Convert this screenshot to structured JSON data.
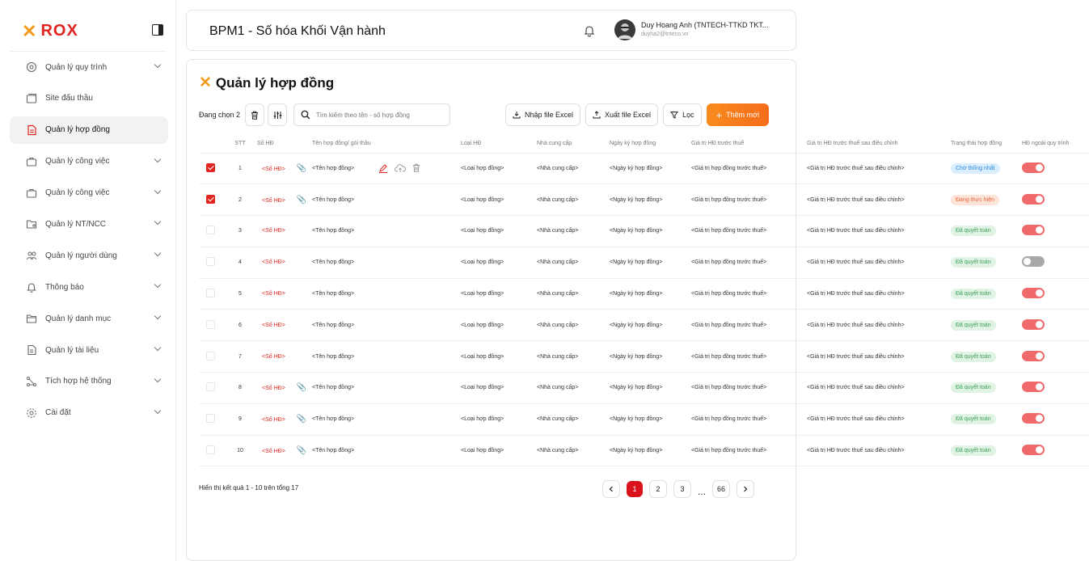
{
  "brand": {
    "name": "ROX"
  },
  "header": {
    "title": "BPM1 - Số hóa Khối Vận hành",
    "user_name": "Duy Hoang Anh (TNTECH-TTKD TKT...",
    "user_email": "duyha2@tnteco.vn"
  },
  "sidebar": {
    "items": [
      {
        "label": "Quản lý quy trình",
        "icon": "process-icon"
      },
      {
        "label": "Site đấu thầu",
        "icon": "window-icon"
      },
      {
        "label": "Quản lý hợp đồng",
        "icon": "document-icon"
      },
      {
        "label": "Quản lý công việc",
        "icon": "briefcase-icon"
      },
      {
        "label": "Quản lý công việc",
        "icon": "briefcase-icon"
      },
      {
        "label": "Quản lý NT/NCC",
        "icon": "folder-user-icon"
      },
      {
        "label": "Quản lý người dùng",
        "icon": "users-icon"
      },
      {
        "label": "Thông báo",
        "icon": "bell-icon"
      },
      {
        "label": "Quản lý danh mục",
        "icon": "folder-icon"
      },
      {
        "label": "Quản lý tài liệu",
        "icon": "file-icon"
      },
      {
        "label": "Tích hợp hệ thống",
        "icon": "integration-icon"
      },
      {
        "label": "Cài đặt",
        "icon": "gear-icon"
      }
    ],
    "active_index": 2
  },
  "page": {
    "title": "Quản lý hợp đồng",
    "selected_text": "Đang chọn 2",
    "search_placeholder": "Tìm kiếm theo tên - số hợp đồng",
    "import_label": "Nhập file Excel",
    "export_label": "Xuất file Excel",
    "filter_label": "Lọc",
    "add_label": "Thêm mới"
  },
  "table": {
    "columns": [
      "STT",
      "Số HĐ",
      "Tên hợp đồng/ gói thầu",
      "Loại HĐ",
      "Nhà cung cấp",
      "Ngày ký hợp đồng",
      "Giá trị HĐ trước thuế",
      "Giá trị HĐ trước thuế sau điều chỉnh",
      "Trạng thái hợp đồng",
      "HĐ ngoài quy trình"
    ],
    "rows": [
      {
        "checked": true,
        "stt": "1",
        "so_hd": "<Số HĐ>",
        "clip": true,
        "actions": true,
        "ten": "<Tên hợp đồng>",
        "loai": "<Loại hợp đồng>",
        "ncc": "<Nhà cung cấp>",
        "ngay": "<Ngày ký hợp đồng>",
        "gia": "<Giá trị hợp đồng trước thuế>",
        "gia_dc": "<Giá trị HĐ trước thuế sau điều chỉnh>",
        "status": "Chờ thống nhất",
        "status_color": "blue",
        "toggle": true
      },
      {
        "checked": true,
        "stt": "2",
        "so_hd": "<Số HĐ>",
        "clip": true,
        "actions": false,
        "ten": "<Tên hợp đồng>",
        "loai": "<Loại hợp đồng>",
        "ncc": "<Nhà cung cấp>",
        "ngay": "<Ngày ký hợp đồng>",
        "gia": "<Giá trị hợp đồng trước thuế>",
        "gia_dc": "<Giá trị HĐ trước thuế sau điều chỉnh>",
        "status": "Đang thực hiện",
        "status_color": "orange",
        "toggle": true
      },
      {
        "checked": false,
        "stt": "3",
        "so_hd": "<Số HĐ>",
        "clip": false,
        "actions": false,
        "ten": "<Tên hợp đồng>",
        "loai": "<Loại hợp đồng>",
        "ncc": "<Nhà cung cấp>",
        "ngay": "<Ngày ký hợp đồng>",
        "gia": "<Giá trị hợp đồng trước thuế>",
        "gia_dc": "<Giá trị HĐ trước thuế sau điều chỉnh>",
        "status": "Đã quyết toán",
        "status_color": "green",
        "toggle": true
      },
      {
        "checked": false,
        "stt": "4",
        "so_hd": "<Số HĐ>",
        "clip": false,
        "actions": false,
        "ten": "<Tên hợp đồng>",
        "loai": "<Loại hợp đồng>",
        "ncc": "<Nhà cung cấp>",
        "ngay": "<Ngày ký hợp đồng>",
        "gia": "<Giá trị hợp đồng trước thuế>",
        "gia_dc": "<Giá trị HĐ trước thuế sau điều chỉnh>",
        "status": "Đã quyết toán",
        "status_color": "green",
        "toggle": false
      },
      {
        "checked": false,
        "stt": "5",
        "so_hd": "<Số HĐ>",
        "clip": false,
        "actions": false,
        "ten": "<Tên hợp đồng>",
        "loai": "<Loại hợp đồng>",
        "ncc": "<Nhà cung cấp>",
        "ngay": "<Ngày ký hợp đồng>",
        "gia": "<Giá trị hợp đồng trước thuế>",
        "gia_dc": "<Giá trị HĐ trước thuế sau điều chỉnh>",
        "status": "Đã quyết toán",
        "status_color": "green",
        "toggle": true
      },
      {
        "checked": false,
        "stt": "6",
        "so_hd": "<Số HĐ>",
        "clip": false,
        "actions": false,
        "ten": "<Tên hợp đồng>",
        "loai": "<Loại hợp đồng>",
        "ncc": "<Nhà cung cấp>",
        "ngay": "<Ngày ký hợp đồng>",
        "gia": "<Giá trị hợp đồng trước thuế>",
        "gia_dc": "<Giá trị HĐ trước thuế sau điều chỉnh>",
        "status": "Đã quyết toán",
        "status_color": "green",
        "toggle": true
      },
      {
        "checked": false,
        "stt": "7",
        "so_hd": "<Số HĐ>",
        "clip": false,
        "actions": false,
        "ten": "<Tên hợp đồng>",
        "loai": "<Loại hợp đồng>",
        "ncc": "<Nhà cung cấp>",
        "ngay": "<Ngày ký hợp đồng>",
        "gia": "<Giá trị hợp đồng trước thuế>",
        "gia_dc": "<Giá trị HĐ trước thuế sau điều chỉnh>",
        "status": "Đã quyết toán",
        "status_color": "green",
        "toggle": true
      },
      {
        "checked": false,
        "stt": "8",
        "so_hd": "<Số HĐ>",
        "clip": true,
        "actions": false,
        "ten": "<Tên hợp đồng>",
        "loai": "<Loại hợp đồng>",
        "ncc": "<Nhà cung cấp>",
        "ngay": "<Ngày ký hợp đồng>",
        "gia": "<Giá trị hợp đồng trước thuế>",
        "gia_dc": "<Giá trị HĐ trước thuế sau điều chỉnh>",
        "status": "Đã quyết toán",
        "status_color": "green",
        "toggle": true
      },
      {
        "checked": false,
        "stt": "9",
        "so_hd": "<Số HĐ>",
        "clip": true,
        "actions": false,
        "ten": "<Tên hợp đồng>",
        "loai": "<Loại hợp đồng>",
        "ncc": "<Nhà cung cấp>",
        "ngay": "<Ngày ký hợp đồng>",
        "gia": "<Giá trị hợp đồng trước thuế>",
        "gia_dc": "<Giá trị HĐ trước thuế sau điều chỉnh>",
        "status": "Đã quyết toán",
        "status_color": "green",
        "toggle": true
      },
      {
        "checked": false,
        "stt": "10",
        "so_hd": "<Số HĐ>",
        "clip": true,
        "actions": false,
        "ten": "<Tên hợp đồng>",
        "loai": "<Loại hợp đồng>",
        "ncc": "<Nhà cung cấp>",
        "ngay": "<Ngày ký hợp đồng>",
        "gia": "<Giá trị hợp đồng trước thuế>",
        "gia_dc": "<Giá trị HĐ trước thuế sau điều chỉnh>",
        "status": "Đã quyết toán",
        "status_color": "green",
        "toggle": true
      }
    ]
  },
  "footer": {
    "result_text": "Hiển thị kết quả 1 - 10 trên tổng 17",
    "pages": [
      "1",
      "2",
      "3"
    ],
    "ellipsis": "...",
    "last_page": "66",
    "current_page": "1"
  }
}
